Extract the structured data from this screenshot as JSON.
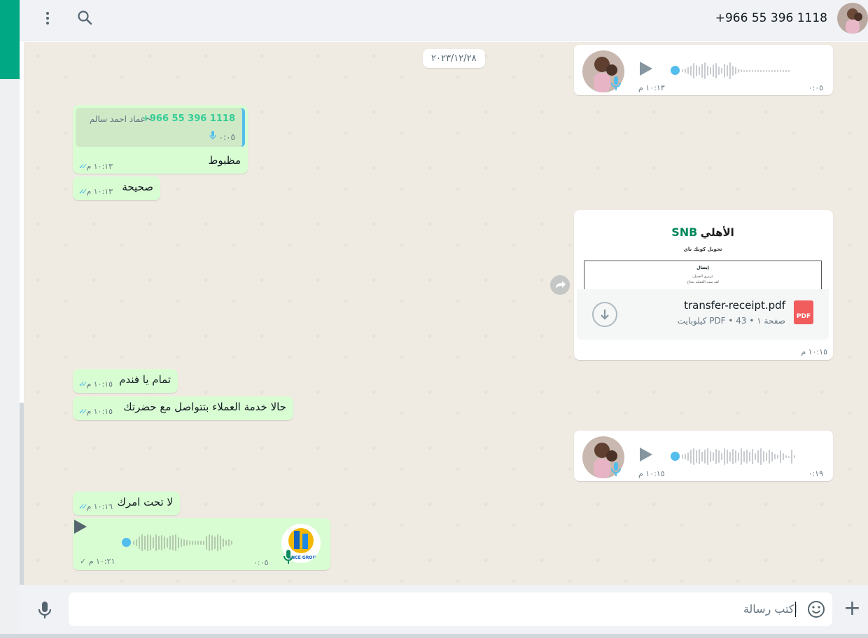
{
  "header": {
    "contact_name": "+966 55 396 1118"
  },
  "chat": {
    "date_chip": "٢٠٢٣/١٢/٢٨",
    "messages": [
      {
        "kind": "voice-in",
        "duration": "٠:٠٥",
        "time": "١٠:١٣ م"
      },
      {
        "kind": "reply-out",
        "quote_name": "+966 55 396 1118",
        "quote_alias": "~عماد احمد سالم",
        "quote_duration": "٠:٠٥",
        "text": "مظبوط",
        "time": "١٠:١٣ م"
      },
      {
        "kind": "text-out",
        "text": "صحيحة",
        "time": "١٠:١٣ م"
      },
      {
        "kind": "pdf-in",
        "filename": "transfer-receipt.pdf",
        "details": "صفحة ١ • PDF • 43 كيلوبايت",
        "time": "١٠:١٥ م",
        "preview_logo_ar": "الأهلي",
        "preview_logo_en": "SNB",
        "preview_title": "تحويل كويك باي",
        "preview_box_title": "إيصال",
        "preview_line1": "عزيزي العميل،",
        "preview_line2": "لقد تمت العملية بنجاح",
        "icon_label": "PDF"
      },
      {
        "kind": "text-out",
        "text": "تمام يا فندم",
        "time": "١٠:١٥ م"
      },
      {
        "kind": "text-out",
        "text": "حالا خدمة العملاء بتتواصل مع حضرتك",
        "time": "١٠:١٥ م"
      },
      {
        "kind": "voice-in",
        "duration": "٠:١٩",
        "time": "١٠:١٥ م"
      },
      {
        "kind": "text-out",
        "text": "لا تحت امرك",
        "time": "١٠:١٦ م"
      },
      {
        "kind": "voice-out",
        "duration": "٠:٠٥",
        "time": "١٠:٢١ م",
        "logo_text": "DIANCE GROUP"
      }
    ]
  },
  "composer": {
    "placeholder": "اكتب رسالة"
  },
  "colors": {
    "outgoing_bubble": "#d9fdd3",
    "incoming_bubble": "#ffffff",
    "chat_background": "#efeae2",
    "read_ticks": "#53bdeb",
    "accent": "#00a884"
  },
  "icons": [
    "menu-icon",
    "search-icon",
    "play-icon",
    "mic-icon",
    "download-icon",
    "forward-icon",
    "emoji-icon",
    "plus-icon",
    "pdf-icon",
    "double-check-icon",
    "single-check-icon"
  ]
}
